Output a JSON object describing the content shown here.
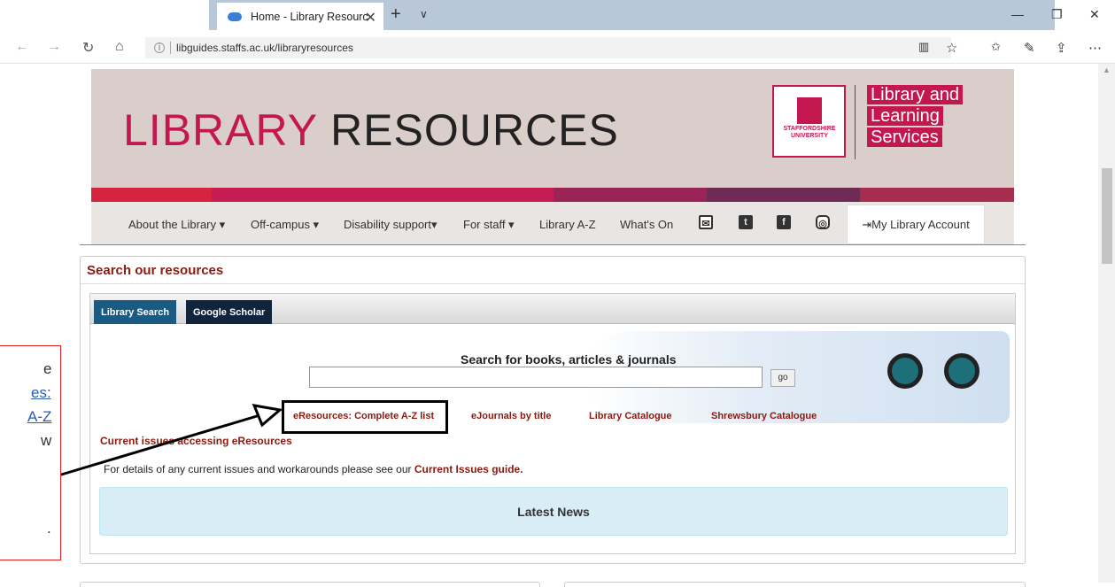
{
  "browser": {
    "tab_title": "Home - Library Resourc",
    "tab_close": "✕",
    "new_tab": "+",
    "tab_menu": "∨",
    "url": "libguides.staffs.ac.uk/libraryresources",
    "window": {
      "min": "—",
      "restore": "❐",
      "close": "✕"
    },
    "nav": {
      "back": "←",
      "forward": "→",
      "refresh": "↻",
      "home": "⌂"
    },
    "right_icons": {
      "reading": "📖",
      "favorite": "☆",
      "favorites": "☆≡",
      "pen": "✎",
      "share": "⇪",
      "more": "⋯"
    }
  },
  "banner": {
    "title_part1": "LIBRARY",
    "title_part2": "RESOURCES",
    "logo_text_line1": "STAFFORDSHIRE",
    "logo_text_line2": "UNIVERSITY",
    "lls": [
      "Library and",
      "Learning",
      "Services"
    ],
    "stripe_colors": [
      "#d4243f",
      "#c51c54",
      "#9b2456",
      "#6e2b56",
      "#a72d4f"
    ]
  },
  "nav": {
    "items": [
      "About the Library ▾",
      "Off-campus ▾",
      "Disability support▾",
      "For staff ▾",
      "Library A-Z",
      "What's On"
    ],
    "icons": [
      "✉",
      "t",
      "f",
      "◎"
    ],
    "account": "⇥My Library Account"
  },
  "search": {
    "panel_title": "Search our resources",
    "tabs": [
      "Library Search",
      "Google Scholar"
    ],
    "tab_colors": [
      "#1b5a83",
      "#10243e"
    ],
    "label": "Search for books, articles & journals",
    "input_value": "",
    "go": "go",
    "links": [
      "eResources: Complete A-Z list",
      "eJournals by title",
      "Library Catalogue",
      "Shrewsbury Catalogue"
    ],
    "current_issues": "Current issues accessing eResources",
    "details_prefix": "For details of any current issues and workarounds please see our ",
    "details_link": "Current Issues guide.",
    "latest_news": "Latest News"
  },
  "callout": {
    "lines": [
      "e",
      "es:",
      "A-Z",
      "w",
      "."
    ]
  }
}
